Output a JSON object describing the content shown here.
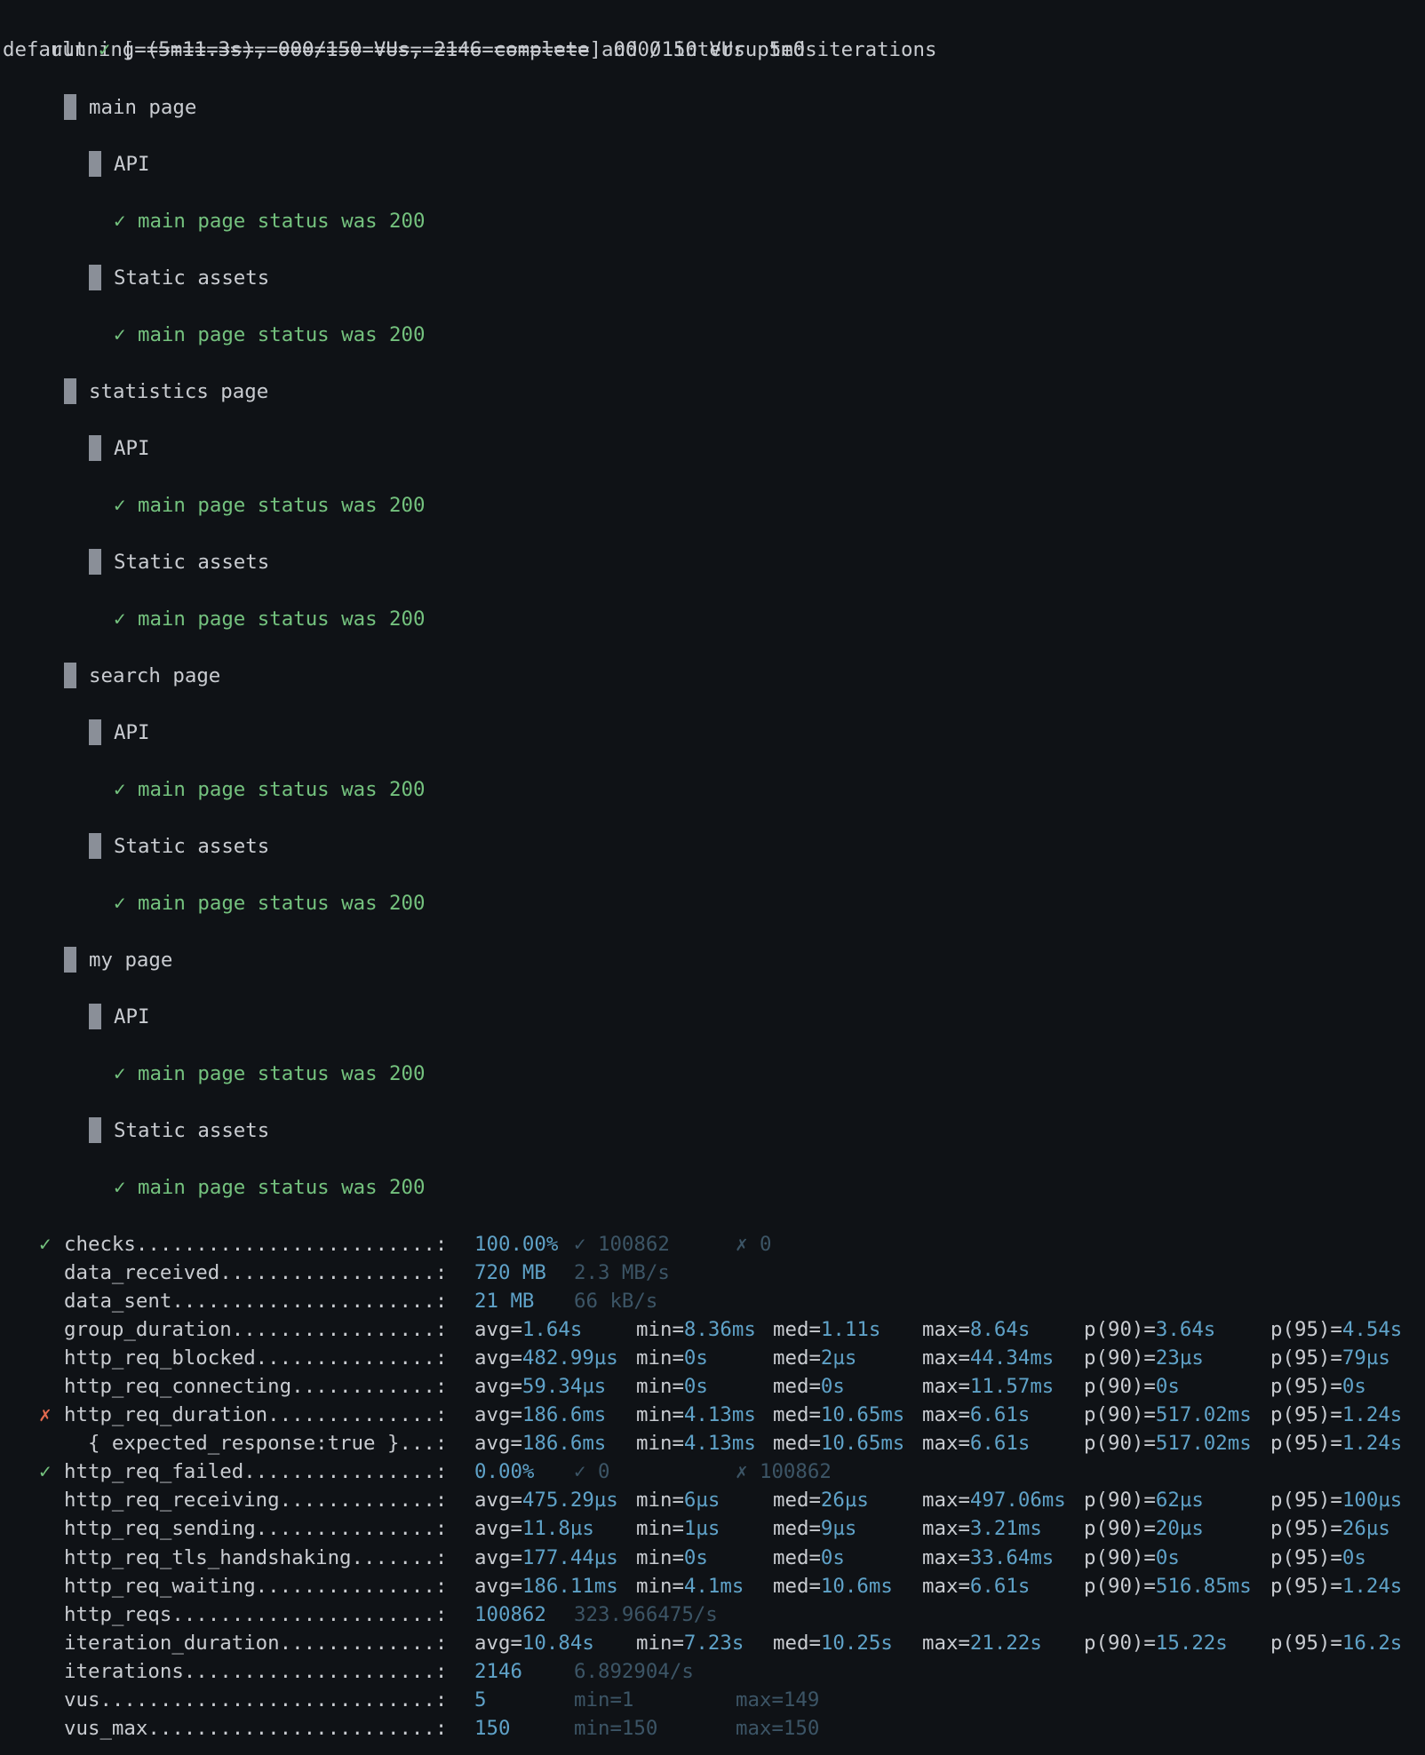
{
  "status_line": "running (5m11.3s), 000/150 VUs, 2146 complete and 0 interrupted iterations",
  "progress": {
    "scenario": "default",
    "mark": "✓",
    "bar": "[======================================]",
    "vus": "000/150 VUs",
    "duration": "5m0s"
  },
  "groups": [
    {
      "name": "main page",
      "subgroups": [
        {
          "name": "API",
          "check": "main page status was 200",
          "mark": "✓"
        },
        {
          "name": "Static assets",
          "check": "main page status was 200",
          "mark": "✓"
        }
      ]
    },
    {
      "name": "statistics page",
      "subgroups": [
        {
          "name": "API",
          "check": "main page status was 200",
          "mark": "✓"
        },
        {
          "name": "Static assets",
          "check": "main page status was 200",
          "mark": "✓"
        }
      ]
    },
    {
      "name": "search page",
      "subgroups": [
        {
          "name": "API",
          "check": "main page status was 200",
          "mark": "✓"
        },
        {
          "name": "Static assets",
          "check": "main page status was 200",
          "mark": "✓"
        }
      ]
    },
    {
      "name": "my page",
      "subgroups": [
        {
          "name": "API",
          "check": "main page status was 200",
          "mark": "✓"
        },
        {
          "name": "Static assets",
          "check": "main page status was 200",
          "mark": "✓"
        }
      ]
    }
  ],
  "metrics": [
    {
      "mark": "✓",
      "mark_color": "green",
      "name": "checks.........................:",
      "type": "rate",
      "value": "100.00%",
      "a": "✓ 100862",
      "b": "✗ 0"
    },
    {
      "mark": "",
      "name": "data_received..................:",
      "type": "counter",
      "value": "720 MB",
      "a": "2.3 MB/s"
    },
    {
      "mark": "",
      "name": "data_sent......................:",
      "type": "counter",
      "value": "21 MB",
      "a": "66 kB/s"
    },
    {
      "mark": "",
      "name": "group_duration.................:",
      "type": "trend",
      "avg": "1.64s",
      "min": "8.36ms",
      "med": "1.11s",
      "max": "8.64s",
      "p90": "3.64s",
      "p95": "4.54s"
    },
    {
      "mark": "",
      "name": "http_req_blocked...............:",
      "type": "trend",
      "avg": "482.99µs",
      "min": "0s",
      "med": "2µs",
      "max": "44.34ms",
      "p90": "23µs",
      "p95": "79µs"
    },
    {
      "mark": "",
      "name": "http_req_connecting............:",
      "type": "trend",
      "avg": "59.34µs",
      "min": "0s",
      "med": "0s",
      "max": "11.57ms",
      "p90": "0s",
      "p95": "0s"
    },
    {
      "mark": "✗",
      "mark_color": "red",
      "name": "http_req_duration..............:",
      "type": "trend",
      "avg": "186.6ms",
      "min": "4.13ms",
      "med": "10.65ms",
      "max": "6.61s",
      "p90": "517.02ms",
      "p95": "1.24s"
    },
    {
      "mark": "",
      "name": "  { expected_response:true }...:",
      "type": "trend",
      "avg": "186.6ms",
      "min": "4.13ms",
      "med": "10.65ms",
      "max": "6.61s",
      "p90": "517.02ms",
      "p95": "1.24s"
    },
    {
      "mark": "✓",
      "mark_color": "green",
      "name": "http_req_failed................:",
      "type": "rate",
      "value": "0.00%",
      "a": "✓ 0",
      "b": "✗ 100862"
    },
    {
      "mark": "",
      "name": "http_req_receiving.............:",
      "type": "trend",
      "avg": "475.29µs",
      "min": "6µs",
      "med": "26µs",
      "max": "497.06ms",
      "p90": "62µs",
      "p95": "100µs"
    },
    {
      "mark": "",
      "name": "http_req_sending...............:",
      "type": "trend",
      "avg": "11.8µs",
      "min": "1µs",
      "med": "9µs",
      "max": "3.21ms",
      "p90": "20µs",
      "p95": "26µs"
    },
    {
      "mark": "",
      "name": "http_req_tls_handshaking.......:",
      "type": "trend",
      "avg": "177.44µs",
      "min": "0s",
      "med": "0s",
      "max": "33.64ms",
      "p90": "0s",
      "p95": "0s"
    },
    {
      "mark": "",
      "name": "http_req_waiting...............:",
      "type": "trend",
      "avg": "186.11ms",
      "min": "4.1ms",
      "med": "10.6ms",
      "max": "6.61s",
      "p90": "516.85ms",
      "p95": "1.24s"
    },
    {
      "mark": "",
      "name": "http_reqs......................:",
      "type": "counter",
      "value": "100862",
      "a": "323.966475/s"
    },
    {
      "mark": "",
      "name": "iteration_duration.............:",
      "type": "trend",
      "avg": "10.84s",
      "min": "7.23s",
      "med": "10.25s",
      "max": "21.22s",
      "p90": "15.22s",
      "p95": "16.2s"
    },
    {
      "mark": "",
      "name": "iterations.....................:",
      "type": "counter",
      "value": "2146",
      "a": "6.892904/s"
    },
    {
      "mark": "",
      "name": "vus............................:",
      "type": "gauge",
      "value": "5",
      "a": "min=1",
      "b": "max=149"
    },
    {
      "mark": "",
      "name": "vus_max........................:",
      "type": "gauge",
      "value": "150",
      "a": "min=150",
      "b": "max=150"
    }
  ],
  "labels": {
    "avg": "avg=",
    "min": "min=",
    "med": "med=",
    "max": "max=",
    "p90": "p(90)=",
    "p95": "p(95)="
  },
  "colors": {
    "background": "#0f1216",
    "text": "#c9ccd1",
    "green": "#74c27e",
    "blue": "#5fa2c8",
    "dim": "#3c5566",
    "red": "#e26a4f",
    "group_bar": "#8a8f98"
  }
}
